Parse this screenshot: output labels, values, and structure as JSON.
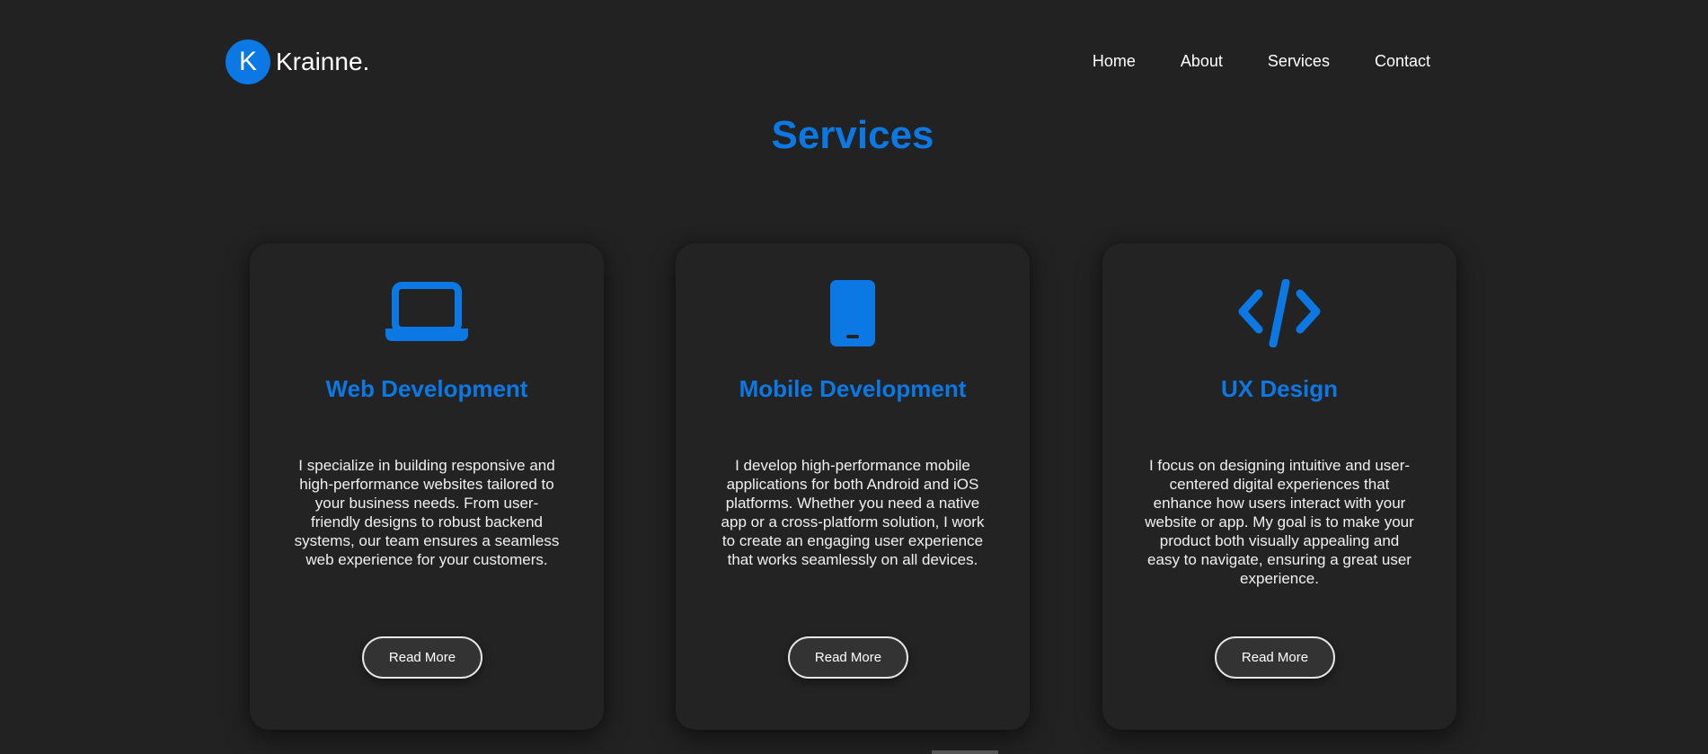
{
  "brand": {
    "badge_letter": "K",
    "name": "Krainne."
  },
  "nav": {
    "items": [
      {
        "label": "Home"
      },
      {
        "label": "About"
      },
      {
        "label": "Services"
      },
      {
        "label": "Contact"
      }
    ]
  },
  "section": {
    "title": "Services"
  },
  "cards": [
    {
      "icon": "laptop-icon",
      "title": "Web Development",
      "description": "I specialize in building responsive and high-performance websites tailored to your business needs. From user-friendly designs to robust backend systems, our team ensures a seamless web experience for your customers.",
      "button_label": "Read More"
    },
    {
      "icon": "mobile-phone-icon",
      "title": "Mobile Development",
      "description": "I develop high-performance mobile applications for both Android and iOS platforms. Whether you need a native app or a cross-platform solution, I work to create an engaging user experience that works seamlessly on all devices.",
      "button_label": "Read More"
    },
    {
      "icon": "code-icon",
      "title": "UX Design",
      "description": "I focus on designing intuitive and user-centered digital experiences that enhance how users interact with your website or app. My goal is to make your product both visually appealing and easy to navigate, ensuring a great user experience.",
      "button_label": "Read More"
    }
  ],
  "colors": {
    "accent": "#0b78e3",
    "background": "#222222",
    "card": "#232323",
    "button": "#333333"
  }
}
